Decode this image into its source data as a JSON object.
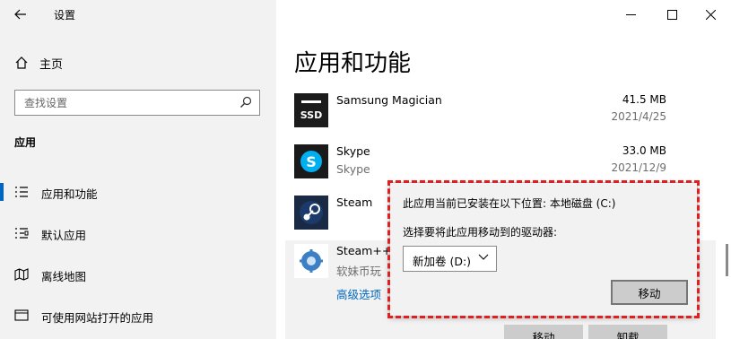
{
  "window": {
    "title": "设置",
    "back_icon": "back-arrow-icon",
    "minimize_icon": "minimize-icon",
    "maximize_icon": "maximize-icon",
    "close_icon": "close-icon"
  },
  "sidebar": {
    "home_label": "主页",
    "search_placeholder": "查找设置",
    "section": "应用",
    "items": [
      {
        "label": "应用和功能",
        "icon": "apps-features-icon",
        "active": true
      },
      {
        "label": "默认应用",
        "icon": "default-apps-icon",
        "active": false
      },
      {
        "label": "离线地图",
        "icon": "offline-maps-icon",
        "active": false
      },
      {
        "label": "可使用网站打开的应用",
        "icon": "apps-for-websites-icon",
        "active": false
      }
    ]
  },
  "main": {
    "title": "应用和功能",
    "apps": [
      {
        "name": "Samsung Magician",
        "publisher": "",
        "size": "41.5 MB",
        "date": "2021/4/25",
        "icon": "samsung-ssd-icon"
      },
      {
        "name": "Skype",
        "publisher": "Skype",
        "size": "33.0 MB",
        "date": "2021/12/9",
        "icon": "skype-icon"
      },
      {
        "name": "Steam",
        "publisher": "",
        "size": "",
        "date": "",
        "icon": "steam-icon"
      },
      {
        "name": "Steam++",
        "publisher": "软妹币玩",
        "size": "",
        "date": "",
        "icon": "steam-plus-icon",
        "link": "高级选项"
      }
    ],
    "move_button": "移动",
    "uninstall_button": "卸载"
  },
  "popup": {
    "current_location": "此应用当前已安装在以下位置: 本地磁盘 (C:)",
    "choose_label": "选择要将此应用移动到的驱动器:",
    "selected_drive": "新加卷 (D:)",
    "move_button": "移动"
  },
  "colors": {
    "accent": "#0067c0",
    "highlight_frame": "#e02020",
    "sidebar_bg": "#f2f2f2"
  }
}
